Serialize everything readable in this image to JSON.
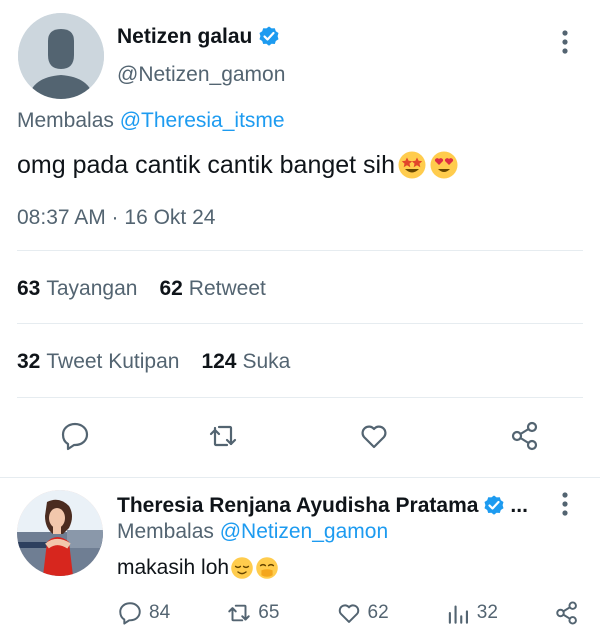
{
  "tweet": {
    "author_name": "Netizen galau",
    "author_handle": "@Netizen_gamon",
    "reply_prefix": "Membalas",
    "reply_to": "@Theresia_itsme",
    "text": "omg pada cantik cantik banget sih",
    "timestamp": "08:37 AM · 16 Okt 24",
    "views_count": "63",
    "views_label": "Tayangan",
    "retweets_count": "62",
    "retweets_label": "Retweet",
    "quotes_count": "32",
    "quotes_label": "Tweet Kutipan",
    "likes_count": "124",
    "likes_label": "Suka"
  },
  "reply": {
    "author_name": "Theresia Renjana Ayudisha Pratama",
    "ellipsis": "...",
    "reply_prefix": "Membalas",
    "reply_to": "@Netizen_gamon",
    "text": "makasih loh",
    "replies": "84",
    "retweets": "65",
    "likes": "62",
    "views": "32"
  },
  "colors": {
    "accent": "#1d9bf0",
    "secondary_text": "#536471",
    "divider": "#e6ecf0"
  }
}
